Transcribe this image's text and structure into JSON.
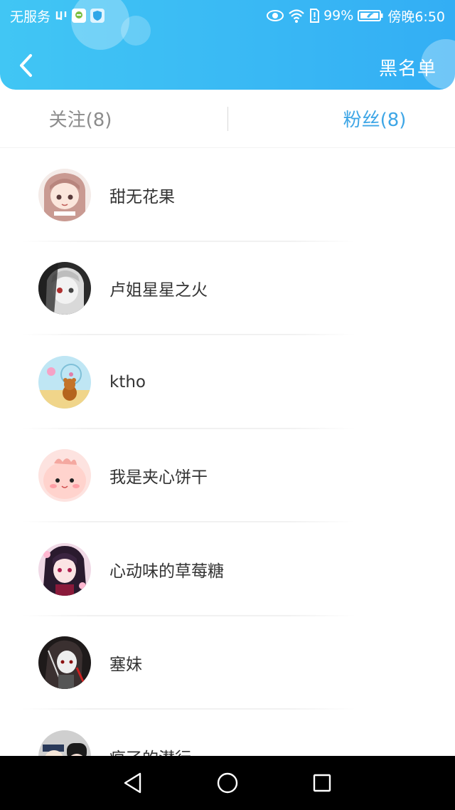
{
  "status_bar": {
    "carrier": "无服务",
    "battery_percent": "99%",
    "time": "傍晚6:50"
  },
  "header": {
    "blacklist_label": "黑名单"
  },
  "tabs": [
    {
      "label": "关注(8)",
      "active": false
    },
    {
      "label": "粉丝(8)",
      "active": true
    }
  ],
  "fans": [
    {
      "name": "甜无花果",
      "avatar": "anime-girl-pink-hair-avatar"
    },
    {
      "name": "卢姐星星之火",
      "avatar": "anime-girl-grayscale-avatar"
    },
    {
      "name": "ktho",
      "avatar": "bear-ferris-wheel-avatar"
    },
    {
      "name": "我是夹心饼干",
      "avatar": "pink-blob-avatar"
    },
    {
      "name": "心动味的草莓糖",
      "avatar": "anime-girl-black-hair-avatar"
    },
    {
      "name": "塞妹",
      "avatar": "anime-girl-dark-avatar"
    },
    {
      "name": "疯了的潜行",
      "avatar": "chibi-characters-avatar"
    }
  ],
  "colors": {
    "header_start": "#41c6f4",
    "header_end": "#33aef4",
    "active_tab": "#3ea6e6",
    "inactive_tab": "#8c8c8c"
  }
}
